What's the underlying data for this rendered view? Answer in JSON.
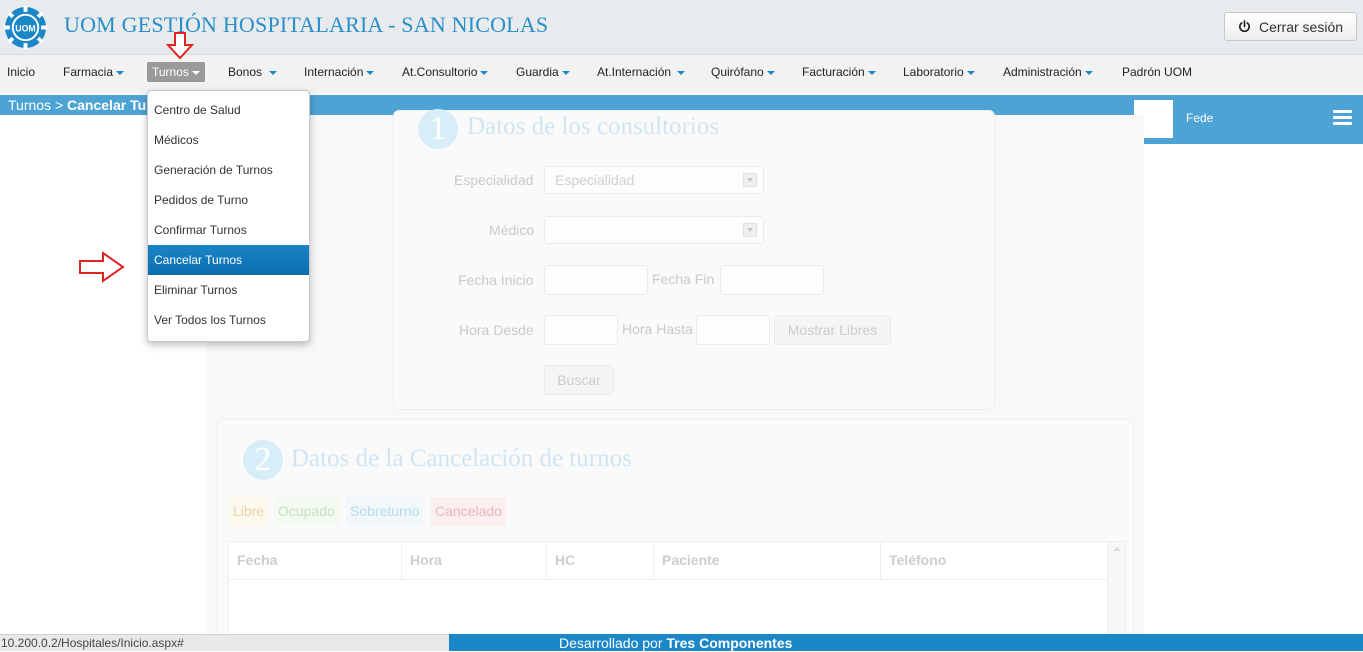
{
  "header": {
    "title": "UOM GESTIÓN HOSPITALARIA - SAN NICOLAS",
    "logo_icon": "uom-gear-logo",
    "logout_label": "Cerrar sesión",
    "logout_icon": "power-icon"
  },
  "nav": {
    "items": [
      {
        "label": "Inicio",
        "has_caret": false
      },
      {
        "label": "Farmacia",
        "has_caret": true
      },
      {
        "label": "Turnos",
        "has_caret": true,
        "active": true
      },
      {
        "label": "Bonos",
        "has_caret": true
      },
      {
        "label": "Internación",
        "has_caret": true
      },
      {
        "label": "At.Consultorio",
        "has_caret": true
      },
      {
        "label": "Guardia",
        "has_caret": true
      },
      {
        "label": "At.Internación",
        "has_caret": true
      },
      {
        "label": "Quirófano",
        "has_caret": true
      },
      {
        "label": "Facturación",
        "has_caret": true
      },
      {
        "label": "Laboratorio",
        "has_caret": true
      },
      {
        "label": "Administración",
        "has_caret": true
      },
      {
        "label": "Padrón UOM",
        "has_caret": false
      }
    ]
  },
  "breadcrumb": {
    "parent": "Turnos",
    "separator": ">",
    "current": "Cancelar Tu"
  },
  "user": {
    "name": "Fede",
    "menu_icon": "hamburger-icon"
  },
  "turnos_menu": {
    "items": [
      "Centro de Salud",
      "Médicos",
      "Generación de Turnos",
      "Pedidos de Turno",
      "Confirmar Turnos",
      "Cancelar Turnos",
      "Eliminar Turnos",
      "Ver Todos los Turnos"
    ],
    "selected": "Cancelar Turnos"
  },
  "section1": {
    "number": "1",
    "title": "Datos de los consultorios",
    "especialidad_label": "Especialidad",
    "especialidad_value": "Especialidad",
    "medico_label": "Médico",
    "medico_value": "",
    "fecha_inicio_label": "Fecha Inicio",
    "fecha_fin_label": "Fecha Fin",
    "hora_desde_label": "Hora Desde",
    "hora_hasta_label": "Hora Hasta",
    "mostrar_libres_label": "Mostrar Libres",
    "buscar_label": "Buscar"
  },
  "section2": {
    "number": "2",
    "title": "Datos de la Cancelación de turnos",
    "legend": [
      {
        "label": "Libre",
        "color": "#fdf9ee"
      },
      {
        "label": "Ocupado",
        "color": "#f3faf0"
      },
      {
        "label": "Sobreturno",
        "color": "#f1f8fc"
      },
      {
        "label": "Cancelado",
        "color": "#fbefef"
      }
    ],
    "columns": [
      "Fecha",
      "Hora",
      "HC",
      "Paciente",
      "Teléfono"
    ]
  },
  "status_bar": {
    "url": "10.200.0.2/Hospitales/Inicio.aspx#"
  },
  "footer": {
    "prefix": "Desarrollado por",
    "company": "Tres Componentes"
  },
  "colors": {
    "brand_blue": "#1b87c9",
    "bar_blue": "#4da3d4",
    "annotation_arrow_red": "#e02424"
  }
}
